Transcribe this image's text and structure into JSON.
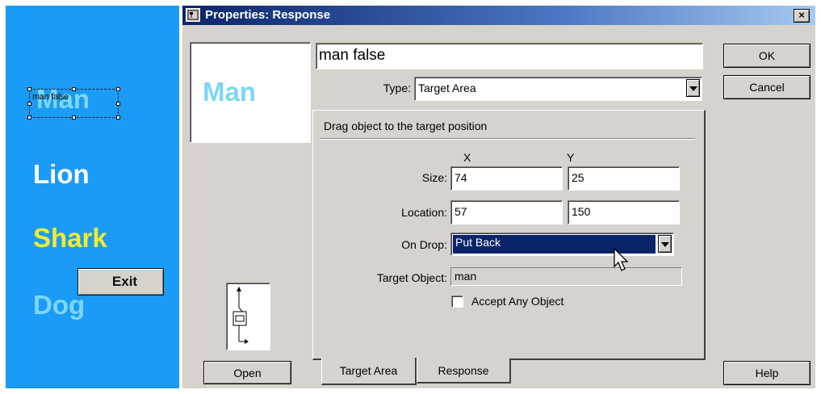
{
  "stage": {
    "words": {
      "man": "Man",
      "lion": "Lion",
      "shark": "Shark",
      "dog": "Dog"
    },
    "target_label": "man false",
    "exit_label": "Exit",
    "colors": {
      "background": "#1a9bf7",
      "lion": "#ffffff",
      "shark": "#f4ec2a",
      "man_dog": "#7dd6f3"
    }
  },
  "dialog": {
    "title": "Properties: Response",
    "close_glyph": "×",
    "preview_word": "Man",
    "open_label": "Open",
    "name_value": "man false",
    "type_label": "Type:",
    "type_value": "Target Area",
    "panel_header": "Drag object to the target position",
    "x_header": "X",
    "y_header": "Y",
    "size_label": "Size:",
    "size_x": "74",
    "size_y": "25",
    "location_label": "Location:",
    "location_x": "57",
    "location_y": "150",
    "ondrop_label": "On Drop:",
    "ondrop_value": "Put Back",
    "target_object_label": "Target Object:",
    "target_object_value": "man",
    "accept_any_label": "Accept Any Object",
    "tabs": [
      "Target Area",
      "Response"
    ],
    "buttons": {
      "ok": "OK",
      "cancel": "Cancel",
      "help": "Help"
    }
  }
}
